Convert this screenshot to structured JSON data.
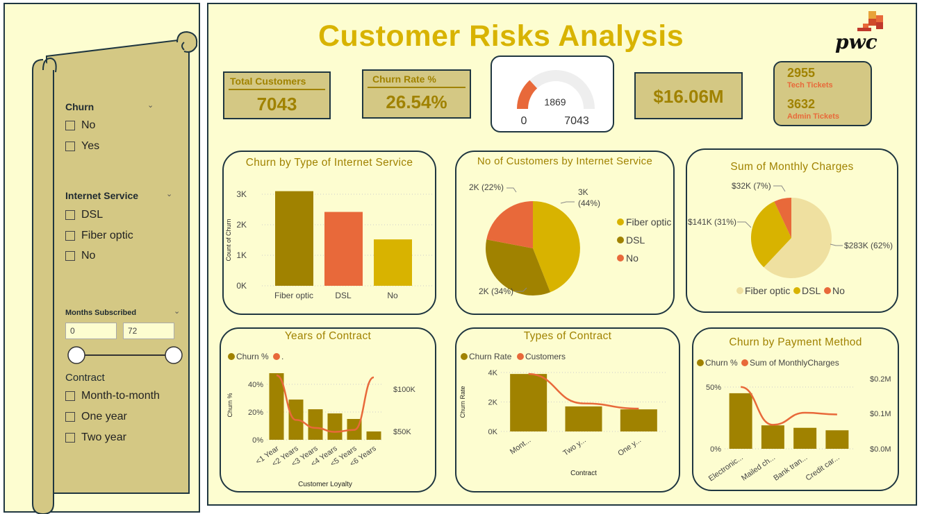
{
  "filters": {
    "churn": {
      "title": "Churn",
      "options": [
        "No",
        "Yes"
      ]
    },
    "internet": {
      "title": "Internet Service",
      "options": [
        "DSL",
        "Fiber optic",
        "No"
      ]
    },
    "months": {
      "title": "Months Subscribed",
      "min": "0",
      "max": "72",
      "slider_min": 0,
      "slider_max": 72
    },
    "contract": {
      "title": "Contract",
      "options": [
        "Month-to-month",
        "One year",
        "Two year"
      ]
    }
  },
  "header": {
    "title": "Customer Risks Analysis",
    "logo": "pwc",
    "logo_icon": "pwc-logo-icon"
  },
  "kpis": {
    "total_customers": {
      "label": "Total Customers",
      "value": "7043"
    },
    "churn_rate": {
      "label": "Churn Rate %",
      "value": "26.54%"
    },
    "gauge": {
      "value": "1869",
      "min": "0",
      "max": "7043",
      "fraction": 0.2654
    },
    "revenue": {
      "value": "$16.06M"
    },
    "tickets": {
      "tech_value": "2955",
      "tech_label": "Tech Tickets",
      "admin_value": "3632",
      "admin_label": "Admin Tickets"
    }
  },
  "colors": {
    "olive": "#a08200",
    "orange": "#e8693a",
    "gold": "#d8b300",
    "light": "#efe0a0",
    "navy": "#1f3640"
  },
  "chart_data": [
    {
      "type": "bar",
      "title": "Churn by Type of Internet Service",
      "ylabel": "Count of Churn",
      "categories": [
        "Fiber optic",
        "DSL",
        "No"
      ],
      "values": [
        3100,
        2420,
        1520
      ],
      "colors": [
        "#a08200",
        "#e8693a",
        "#d8b300"
      ],
      "ylim": [
        0,
        3000
      ],
      "yticks": [
        "0K",
        "1K",
        "2K",
        "3K"
      ]
    },
    {
      "type": "pie",
      "title": "No of Customers by Internet Service",
      "slices": [
        {
          "label": "Fiber optic",
          "value": 44,
          "color": "#d8b300",
          "data_label": "3K",
          "pct_label": "(44%)"
        },
        {
          "label": "DSL",
          "value": 34,
          "color": "#a08200",
          "data_label": "2K (34%)"
        },
        {
          "label": "No",
          "value": 22,
          "color": "#e8693a",
          "data_label": "2K (22%)"
        }
      ]
    },
    {
      "type": "pie",
      "title": "Sum of Monthly Charges",
      "slices": [
        {
          "label": "Fiber optic",
          "value": 62,
          "color": "#efe0a0",
          "data_label": "$283K (62%)"
        },
        {
          "label": "DSL",
          "value": 31,
          "color": "#d8b300",
          "data_label": "$141K (31%)"
        },
        {
          "label": "No",
          "value": 7,
          "color": "#e8693a",
          "data_label": "$32K (7%)"
        }
      ],
      "legend": "bottom"
    },
    {
      "type": "bar",
      "title": "Years of Contract",
      "legend": [
        "Churn %",
        "."
      ],
      "xlabel": "Customer Loyalty",
      "ylabel": "Churn %",
      "categories": [
        "<1 Year",
        "<2 Years",
        "<3 Years",
        "<4 Years",
        "<5 Years",
        "<6 Years"
      ],
      "values": [
        48,
        29,
        22,
        19,
        15,
        6
      ],
      "ylim": [
        0,
        50
      ],
      "yticks": [
        "0%",
        "20%",
        "40%"
      ],
      "y2ticks": [
        "$50K",
        "$100K"
      ],
      "line": [
        105,
        60,
        52,
        48,
        50,
        103
      ]
    },
    {
      "type": "bar",
      "title": "Types of Contract",
      "legend": [
        "Churn Rate",
        "Customers"
      ],
      "xlabel": "Contract",
      "ylabel": "Churn Rate",
      "categories": [
        "Mont...",
        "Two y...",
        "One y..."
      ],
      "values": [
        3900,
        1700,
        1500
      ],
      "ylim": [
        0,
        4000
      ],
      "yticks": [
        "0K",
        "2K",
        "4K"
      ],
      "line": [
        3900,
        1900,
        1550
      ]
    },
    {
      "type": "bar",
      "title": "Churn by Payment Method",
      "legend": [
        "Churn %",
        "Sum of MonthlyCharges"
      ],
      "categories": [
        "Electronic...",
        "Mailed ch...",
        "Bank tran...",
        "Credit car..."
      ],
      "values": [
        45,
        19,
        17,
        15
      ],
      "ylim": [
        0,
        50
      ],
      "yticks": [
        "0%",
        "50%"
      ],
      "y2ticks": [
        "$0.0M",
        "$0.1M",
        "$0.2M"
      ],
      "line": [
        0.18,
        0.07,
        0.105,
        0.1
      ]
    }
  ]
}
